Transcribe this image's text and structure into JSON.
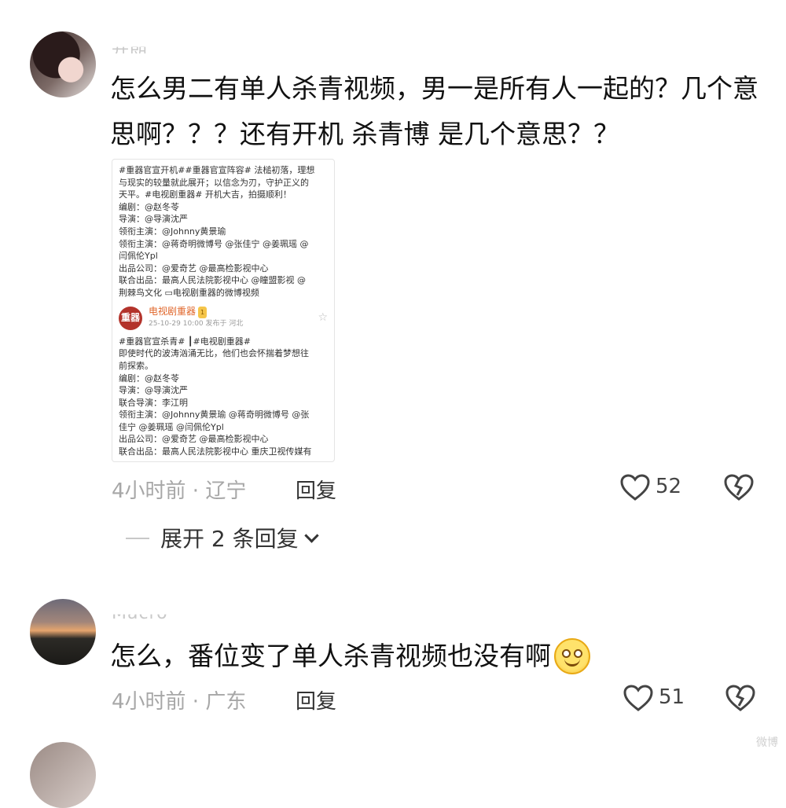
{
  "comments": [
    {
      "username": "开朗",
      "text": "怎么男二有单人杀青视频，男一是所有人一起的？几个意思啊？？？还有开机 杀青博 是几个意思？？",
      "time_location": "4小时前 · 辽宁",
      "reply_label": "回复",
      "likes": "52",
      "expand_label": "展开 2 条回复",
      "embed": {
        "post1": [
          "#重器官宣开机##重器官宣阵容# 法槌初落，理想",
          "与现实的较量就此展开；以信念为刃，守护正义的",
          "天平。#电视剧重器# 开机大吉，拍摄顺利！",
          "编剧：@赵冬苓",
          "导演：@导演沈严",
          "领衔主演：@Johnny黄景瑜",
          "领衔主演：@蒋奇明微博号 @张佳宁 @姜珮瑶 @",
          "闫佩伦Ypl",
          "出品公司：@爱奇艺 @最高检影视中心",
          "联合出品：最高人民法院影视中心 @瞳盟影视 @",
          "荆棘鸟文化 ▭电视剧重器的微博视频"
        ],
        "author": "电视剧重器",
        "author_logo": "重器",
        "vip": "1",
        "date": "25-10-29 10:00  发布于 河北",
        "post2": [
          "#重器官宣杀青# ┃#电视剧重器#",
          "即使时代的波涛汹涌无比，他们也会怀揣着梦想往",
          "前探索。",
          "编剧：@赵冬苓",
          "导演：@导演沈严",
          "联合导演：李江明",
          "领衔主演：@Johnny黄景瑜 @蒋奇明微博号 @张",
          "佳宁 @姜珮瑶 @闫佩伦Ypl",
          "出品公司：@爱奇艺 @最高检影视中心",
          "联合出品：最高人民法院影视中心 重庆卫视传媒有"
        ]
      }
    },
    {
      "username": "Macro",
      "text": "怎么，番位变了单人杀青视频也没有啊",
      "time_location": "4小时前 · 广东",
      "reply_label": "回复",
      "likes": "51"
    }
  ],
  "icons": {
    "like": "heart-outline-icon",
    "dislike": "broken-heart-icon",
    "expand": "chevron-down-icon",
    "emoji": "smile-emoji-icon"
  },
  "watermark": "微博"
}
